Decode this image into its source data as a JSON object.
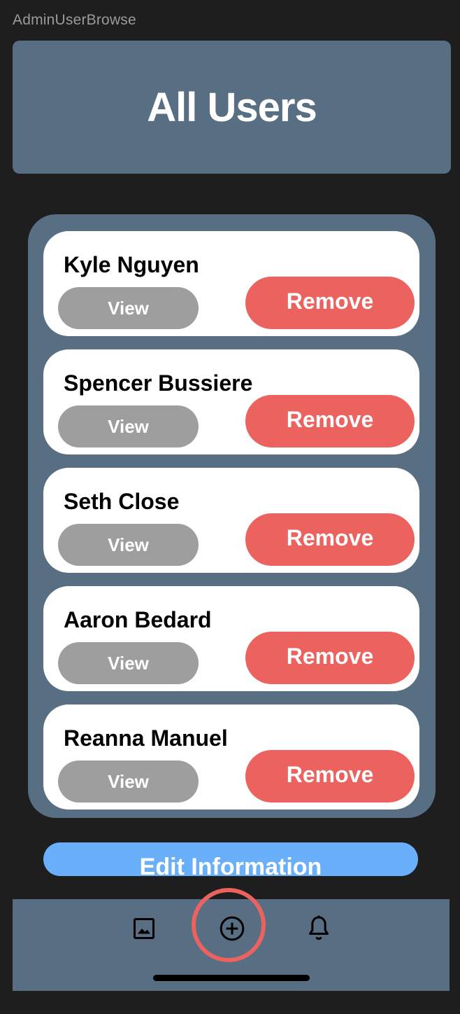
{
  "frame_label": "AdminUserBrowse",
  "header": {
    "title": "All Users"
  },
  "users": [
    {
      "name": "Kyle Nguyen",
      "view_label": "View",
      "remove_label": "Remove"
    },
    {
      "name": "Spencer Bussiere",
      "view_label": "View",
      "remove_label": "Remove"
    },
    {
      "name": "Seth Close",
      "view_label": "View",
      "remove_label": "Remove"
    },
    {
      "name": "Aaron Bedard",
      "view_label": "View",
      "remove_label": "Remove"
    },
    {
      "name": "Reanna Manuel",
      "view_label": "View",
      "remove_label": "Remove"
    }
  ],
  "edit_button": {
    "label": "Edit Information"
  },
  "tabbar": {
    "items": [
      {
        "icon": "photo-icon"
      },
      {
        "icon": "add-circle-icon",
        "highlighted": true
      },
      {
        "icon": "bell-icon"
      }
    ]
  },
  "colors": {
    "background": "#1e1e1e",
    "panel": "#586e83",
    "remove": "#ec625e",
    "view": "#9e9e9e",
    "edit": "#6aaffa",
    "highlight": "#ec625e"
  }
}
